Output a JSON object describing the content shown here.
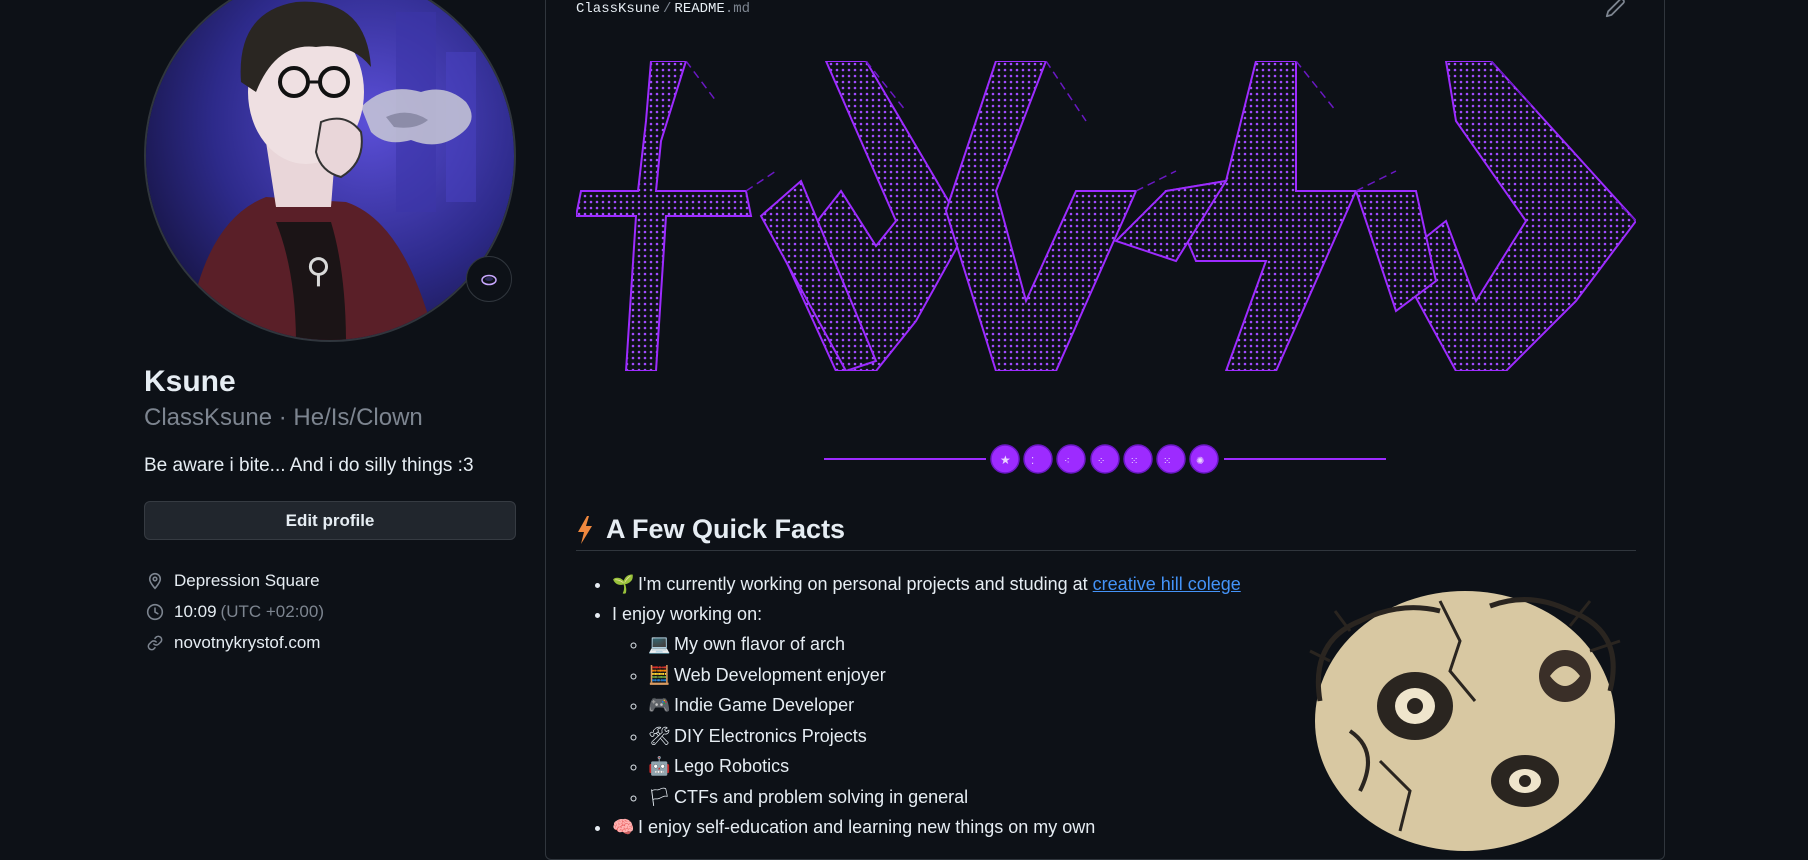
{
  "profile": {
    "display_name": "Ksune",
    "username": "ClassKsune",
    "separator": "·",
    "pronouns": "He/Is/Clown",
    "bio": "Be aware i bite... And i do silly things :3",
    "edit_button": "Edit profile",
    "location": "Depression Square",
    "local_time": "10:09",
    "timezone": "(UTC +02:00)",
    "website": "novotnykrystof.com"
  },
  "readme": {
    "owner": "ClassKsune",
    "path_separator": "/",
    "file_base": "README",
    "file_ext": ".md",
    "banner_text": "KSUNE",
    "banner_color": "#9d2bff",
    "divider_balls": 7,
    "section_title": "A Few Quick Facts",
    "facts": {
      "item1_text": "I'm currently working on personal projects and studing at ",
      "item1_link": "creative hill colege",
      "item2_text": "I enjoy working on:",
      "sub": [
        {
          "emoji": "💻",
          "text": "My own flavor of arch"
        },
        {
          "emoji": "🧮",
          "text": "Web Development enjoyer"
        },
        {
          "emoji": "🎮",
          "text": "Indie Game Developer"
        },
        {
          "emoji": "🛠",
          "text": "DIY Electronics Projects"
        },
        {
          "emoji": "🤖",
          "text": "Lego Robotics"
        },
        {
          "emoji": "🏳",
          "text": "CTFs and problem solving in general"
        }
      ],
      "item3_text": "I enjoy self-education and learning new things on my own"
    }
  },
  "colors": {
    "background": "#0d1117",
    "text": "#e6edf3",
    "muted": "#7d8590",
    "link": "#4493f8",
    "accent_purple": "#9d2bff",
    "bolt_orange": "#f0883e"
  }
}
